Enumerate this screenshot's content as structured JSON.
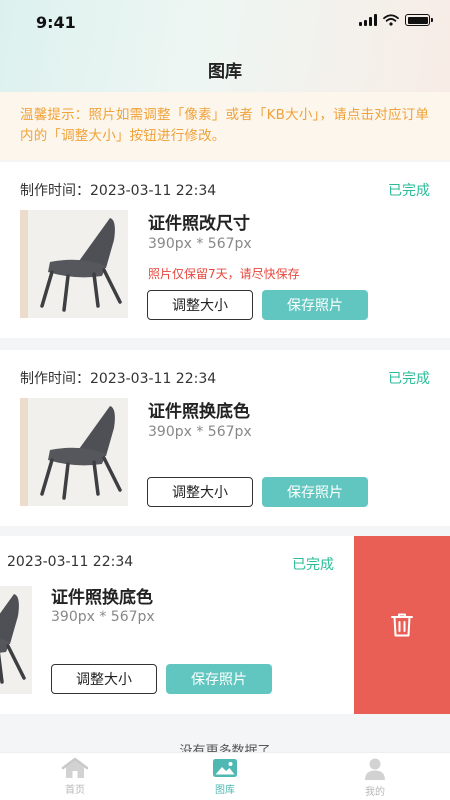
{
  "status_bar": {
    "time": "9:41"
  },
  "header": {
    "title": "图库"
  },
  "tip": {
    "text": "温馨提示：照片如需调整「像素」或者「KB大小」，请点击对应订单内的「调整大小」按钮进行修改。"
  },
  "cards": [
    {
      "time_label": "制作时间：",
      "time": "2023-03-11 22:34",
      "status": "已完成",
      "name": "证件照改尺寸",
      "size": "390px * 567px",
      "warning": "照片仅保留7天，请尽快保存",
      "resize_label": "调整大小",
      "save_label": "保存照片"
    },
    {
      "time_label": "制作时间：",
      "time": "2023-03-11 22:34",
      "status": "已完成",
      "name": "证件照换底色",
      "size": "390px * 567px",
      "resize_label": "调整大小",
      "save_label": "保存照片"
    },
    {
      "time": "2023-03-11 22:34",
      "status": "已完成",
      "name": "证件照换底色",
      "size": "390px * 567px",
      "resize_label": "调整大小",
      "save_label": "保存照片",
      "delete_icon": "trash-icon"
    }
  ],
  "footer": {
    "no_more": "没有更多数据了"
  },
  "tabbar": {
    "items": [
      {
        "label": "首页",
        "icon": "home-icon",
        "active": false
      },
      {
        "label": "图库",
        "icon": "gallery-icon",
        "active": true
      },
      {
        "label": "我的",
        "icon": "user-icon",
        "active": false
      }
    ]
  },
  "colors": {
    "accent": "#62c6c0",
    "status_done": "#2bbd9a",
    "warning": "#e8473d",
    "tip_text": "#f0a23a",
    "delete": "#e95f55"
  }
}
